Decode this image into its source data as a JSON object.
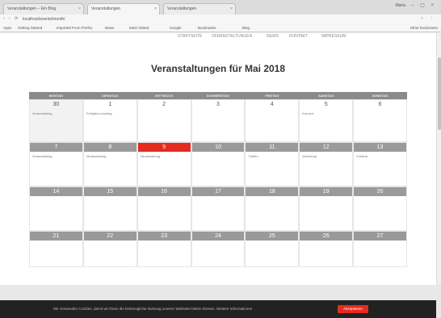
{
  "browser": {
    "tabs": [
      "Veranstaltungen – Ein Blog",
      "Veranstaltungen",
      "Veranstaltungen"
    ],
    "window_label": "Maria",
    "url": "localhost/events/month/",
    "nav_glyphs": "‹ › ⟳",
    "tool_glyphs": "☆ ⋮"
  },
  "bookmarks": {
    "items": [
      "Apps",
      "Getting Started",
      "Imported From Firefox",
      "News",
      "Most Visited",
      "Google",
      "Bookmarks",
      "Blog"
    ],
    "other": "Other bookmarks"
  },
  "site_nav": [
    "STARTSEITE",
    "VERANSTALTUNGEN",
    "NEWS",
    "KONTAKT",
    "IMPRESSUM"
  ],
  "page_title": "Veranstaltungen für Mai 2018",
  "calendar": {
    "weekdays": [
      "MONTAG",
      "DIENSTAG",
      "MITTWOCH",
      "DONNERSTAG",
      "FREITAG",
      "SAMSTAG",
      "SONNTAG"
    ],
    "weeks": [
      [
        {
          "d": "30",
          "ev": "Veranstaltung",
          "grey": true
        },
        {
          "d": "1",
          "ev": "Frühjahrs-Ausflug",
          "grey": false
        },
        {
          "d": "2",
          "ev": "",
          "grey": false
        },
        {
          "d": "3",
          "ev": "",
          "grey": false
        },
        {
          "d": "4",
          "ev": "",
          "grey": false
        },
        {
          "d": "5",
          "ev": "Konzert",
          "grey": false
        },
        {
          "d": "6",
          "ev": "",
          "grey": false
        }
      ],
      [
        {
          "d": "7",
          "ev": "Veranstaltung",
          "grey": false
        },
        {
          "d": "8",
          "ev": "Veranstaltung",
          "grey": false
        },
        {
          "d": "9",
          "ev": "Veranstaltung",
          "grey": false,
          "today": true
        },
        {
          "d": "10",
          "ev": "",
          "grey": false
        },
        {
          "d": "11",
          "ev": "Treffen",
          "grey": false
        },
        {
          "d": "12",
          "ev": "Workshop",
          "grey": false
        },
        {
          "d": "13",
          "ev": "Festival",
          "grey": false
        }
      ],
      [
        {
          "d": "14",
          "ev": "",
          "grey": false
        },
        {
          "d": "15",
          "ev": "",
          "grey": false
        },
        {
          "d": "16",
          "ev": "",
          "grey": false
        },
        {
          "d": "17",
          "ev": "",
          "grey": false
        },
        {
          "d": "18",
          "ev": "",
          "grey": false
        },
        {
          "d": "19",
          "ev": "",
          "grey": false
        },
        {
          "d": "20",
          "ev": "",
          "grey": false
        }
      ],
      [
        {
          "d": "21",
          "ev": "",
          "grey": false
        },
        {
          "d": "22",
          "ev": "",
          "grey": false
        },
        {
          "d": "23",
          "ev": "",
          "grey": false
        },
        {
          "d": "24",
          "ev": "",
          "grey": false
        },
        {
          "d": "25",
          "ev": "",
          "grey": false
        },
        {
          "d": "26",
          "ev": "",
          "grey": false
        },
        {
          "d": "27",
          "ev": "",
          "grey": false
        }
      ]
    ]
  },
  "cookie": {
    "message": "Wir verwenden Cookies, damit wir Ihnen die bestmögliche Nutzung unserer Webseite bieten können. Weitere Informationen",
    "button": "Akzeptieren"
  },
  "colors": {
    "accent": "#e52a1e",
    "header": "#8a8a8a"
  }
}
